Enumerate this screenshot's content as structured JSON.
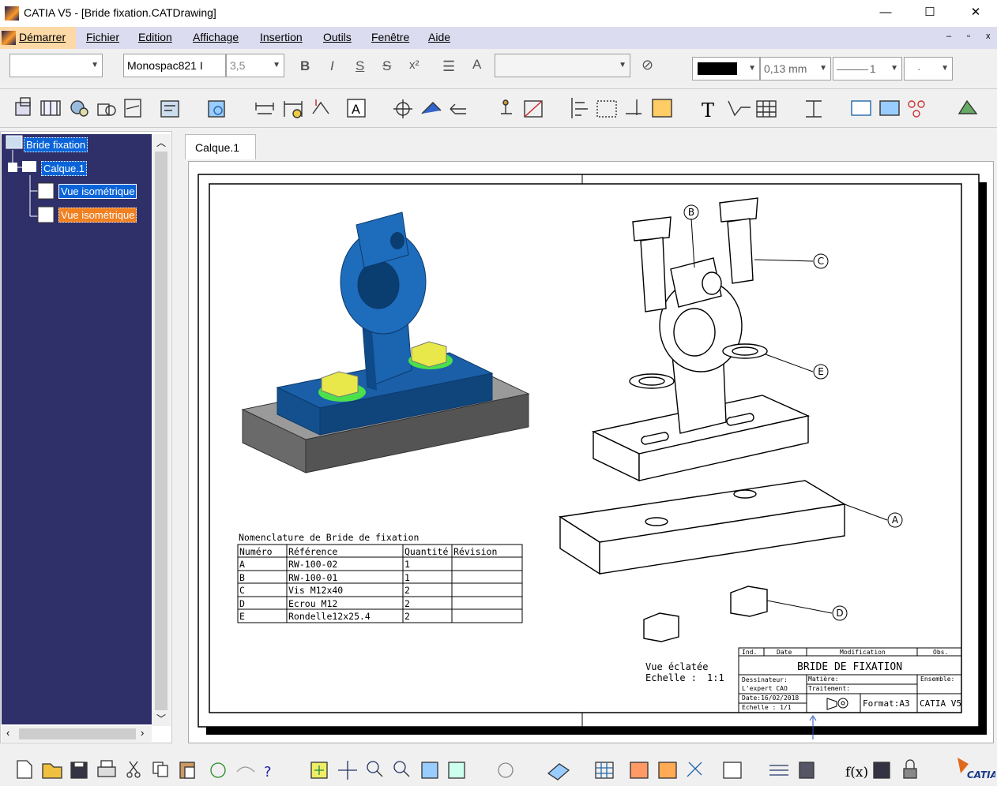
{
  "window": {
    "title": "CATIA V5 - [Bride fixation.CATDrawing]",
    "controls": [
      "—",
      "☐",
      "✕"
    ]
  },
  "menu": {
    "start": "Démarrer",
    "items": [
      "Fichier",
      "Edition",
      "Affichage",
      "Insertion",
      "Outils",
      "Fenêtre",
      "Aide"
    ]
  },
  "format_toolbar": {
    "style": "",
    "font": "Monospac821 I",
    "size": "3,5",
    "bold": "B",
    "italic": "I",
    "underline": "S",
    "strike": "S",
    "super": "x²",
    "line_color": "#000000",
    "line_weight": "0,13 mm",
    "line_type": "1",
    "point": "·"
  },
  "tree": {
    "root": "Bride fixation",
    "sheet": "Calque.1",
    "views": [
      "Vue isométrique",
      "Vue isométrique"
    ]
  },
  "sheet_tab": "Calque.1",
  "drawing": {
    "bom_title": "Nomenclature de Bride de fixation",
    "bom_headers": [
      "Numéro",
      "Référence",
      "Quantité",
      "Révision"
    ],
    "bom_rows": [
      [
        "A",
        "RW-100-02",
        "1",
        ""
      ],
      [
        "B",
        "RW-100-01",
        "1",
        ""
      ],
      [
        "C",
        "Vis M12x40",
        "2",
        ""
      ],
      [
        "D",
        "Ecrou M12",
        "2",
        ""
      ],
      [
        "E",
        "Rondelle12x25.4",
        "2",
        ""
      ]
    ],
    "balloons": [
      "B",
      "C",
      "E",
      "A",
      "D"
    ],
    "view_label": "Vue éclatée",
    "scale_label": "Echelle :",
    "scale_value": "1:1",
    "title_block": {
      "ind": "Ind.",
      "date": "Date",
      "modification": "Modification",
      "obs": "Obs.",
      "title": "BRIDE DE FIXATION",
      "dessinateur": "Dessinateur:",
      "author": "L'expert CAO",
      "matiere": "Matière:",
      "traitement": "Traitement:",
      "ensemble": "Ensemble:",
      "date_val": "Date:16/02/2018",
      "echelle": "Echelle : 1/1",
      "format": "Format:A3",
      "software": "CATIA V5"
    }
  },
  "brand": "CATIA",
  "colors": {
    "part_blue": "#1a5fa8",
    "bolt_yellow": "#e8e84a",
    "washer_green": "#4ce04a",
    "base_gray": "#6a6a6a",
    "tree_bg": "#2f2f6a",
    "select_blue": "#0a64d8",
    "select_orange": "#f08020"
  }
}
